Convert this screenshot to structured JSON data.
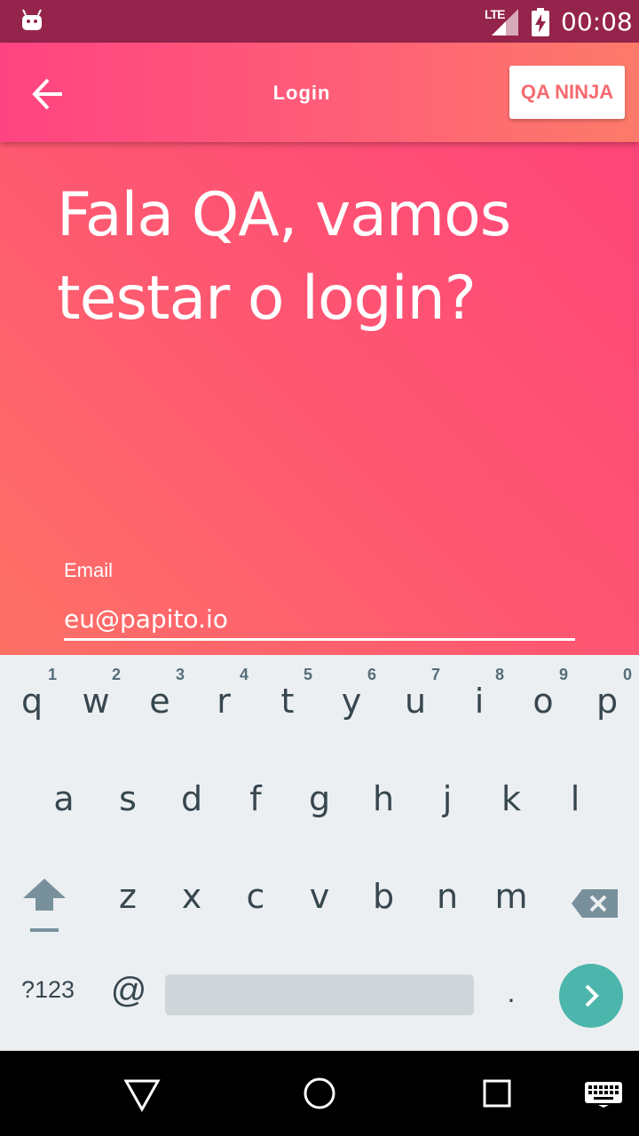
{
  "status_bar": {
    "network_type": "LTE",
    "time": "00:08",
    "icons": [
      "android-debug-icon",
      "lte-signal-icon",
      "battery-charging-icon"
    ]
  },
  "toolbar": {
    "back_icon": "arrow-back-icon",
    "title": "Login",
    "brand_button": "QA NINJA"
  },
  "main": {
    "headline_line1": "Fala QA, vamos",
    "headline_line2": "testar o login?",
    "email_label": "Email",
    "email_value": "eu@papito.io"
  },
  "keyboard": {
    "row1": [
      {
        "key": "q",
        "hint": "1"
      },
      {
        "key": "w",
        "hint": "2"
      },
      {
        "key": "e",
        "hint": "3"
      },
      {
        "key": "r",
        "hint": "4"
      },
      {
        "key": "t",
        "hint": "5"
      },
      {
        "key": "y",
        "hint": "6"
      },
      {
        "key": "u",
        "hint": "7"
      },
      {
        "key": "i",
        "hint": "8"
      },
      {
        "key": "o",
        "hint": "9"
      },
      {
        "key": "p",
        "hint": "0"
      }
    ],
    "row2": [
      "a",
      "s",
      "d",
      "f",
      "g",
      "h",
      "j",
      "k",
      "l"
    ],
    "row3": [
      "z",
      "x",
      "c",
      "v",
      "b",
      "n",
      "m"
    ],
    "symbols_label": "?123",
    "at_label": "@",
    "period_label": ".",
    "shift_icon": "shift-icon",
    "backspace_icon": "backspace-icon",
    "go_icon": "chevron-right-icon"
  },
  "nav_bar": {
    "icons": [
      "nav-back-icon",
      "nav-home-icon",
      "nav-recents-icon",
      "keyboard-icon"
    ]
  },
  "colors": {
    "status_bar": "#95244c",
    "gradient_start": "#ff4382",
    "gradient_end": "#fd7b6a",
    "brand_text": "#f66a6f",
    "keyboard_bg": "#eceff1",
    "go_key": "#4db6ac"
  }
}
